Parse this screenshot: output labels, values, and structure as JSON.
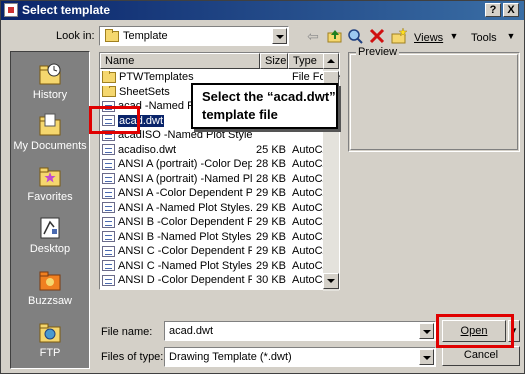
{
  "window": {
    "title": "Select template",
    "help_button": "?",
    "close_button": "X"
  },
  "toolbar": {
    "look_in_label": "Look in:",
    "look_in_value": "Template",
    "views_label": "Views",
    "tools_label": "Tools"
  },
  "places": [
    {
      "label": "History",
      "icon": "history-icon"
    },
    {
      "label": "My Documents",
      "icon": "my-documents-icon"
    },
    {
      "label": "Favorites",
      "icon": "favorites-icon"
    },
    {
      "label": "Desktop",
      "icon": "desktop-icon"
    },
    {
      "label": "Buzzsaw",
      "icon": "buzzsaw-icon"
    },
    {
      "label": "FTP",
      "icon": "ftp-icon"
    }
  ],
  "file_list": {
    "columns": [
      "Name",
      "Size",
      "Type"
    ],
    "rows": [
      {
        "name": "PTWTemplates",
        "size": "",
        "type": "File Folder",
        "kind": "folder"
      },
      {
        "name": "SheetSets",
        "size": "",
        "type": "File Folder",
        "kind": "folder"
      },
      {
        "name": "acad -Named Plot Styles.dwt",
        "size": "",
        "type": "",
        "kind": "dwt"
      },
      {
        "name": "acad.dwt",
        "size": "",
        "type": "",
        "kind": "dwt",
        "selected": true
      },
      {
        "name": "acadISO -Named Plot Styles.dwt",
        "size": "",
        "type": "",
        "kind": "dwt"
      },
      {
        "name": "acadiso.dwt",
        "size": "25 KB",
        "type": "AutoCAD",
        "kind": "dwt"
      },
      {
        "name": "ANSI A (portrait) -Color Dependent Plot Styles.dwt",
        "size": "28 KB",
        "type": "AutoCAD",
        "kind": "dwt"
      },
      {
        "name": "ANSI A (portrait) -Named Plot Styles.dwt",
        "size": "28 KB",
        "type": "AutoCAD",
        "kind": "dwt"
      },
      {
        "name": "ANSI A -Color Dependent Plot Styles.dwt",
        "size": "29 KB",
        "type": "AutoCAD",
        "kind": "dwt"
      },
      {
        "name": "ANSI A -Named Plot Styles.dwt",
        "size": "29 KB",
        "type": "AutoCAD",
        "kind": "dwt"
      },
      {
        "name": "ANSI B -Color Dependent Plot Styles.dwt",
        "size": "29 KB",
        "type": "AutoCAD",
        "kind": "dwt"
      },
      {
        "name": "ANSI B -Named Plot Styles.dwt",
        "size": "29 KB",
        "type": "AutoCAD",
        "kind": "dwt"
      },
      {
        "name": "ANSI C -Color Dependent Plot Styles.dwt",
        "size": "29 KB",
        "type": "AutoCAD",
        "kind": "dwt"
      },
      {
        "name": "ANSI C -Named Plot Styles.dwt",
        "size": "29 KB",
        "type": "AutoCAD",
        "kind": "dwt"
      },
      {
        "name": "ANSI D -Color Dependent Plot Styles.dwt",
        "size": "30 KB",
        "type": "AutoCAD",
        "kind": "dwt"
      }
    ]
  },
  "preview": {
    "label": "Preview"
  },
  "callout": {
    "line1": "Select the “acad.dwt”",
    "line2": "template file"
  },
  "file_name": {
    "label": "File name:",
    "value": "acad.dwt"
  },
  "file_type": {
    "label": "Files of type:",
    "value": "Drawing Template (*.dwt)"
  },
  "buttons": {
    "open": "Open",
    "cancel": "Cancel"
  },
  "colors": {
    "title_bar": "#0a246a",
    "highlight": "#e00000",
    "selection": "#0a246a"
  }
}
